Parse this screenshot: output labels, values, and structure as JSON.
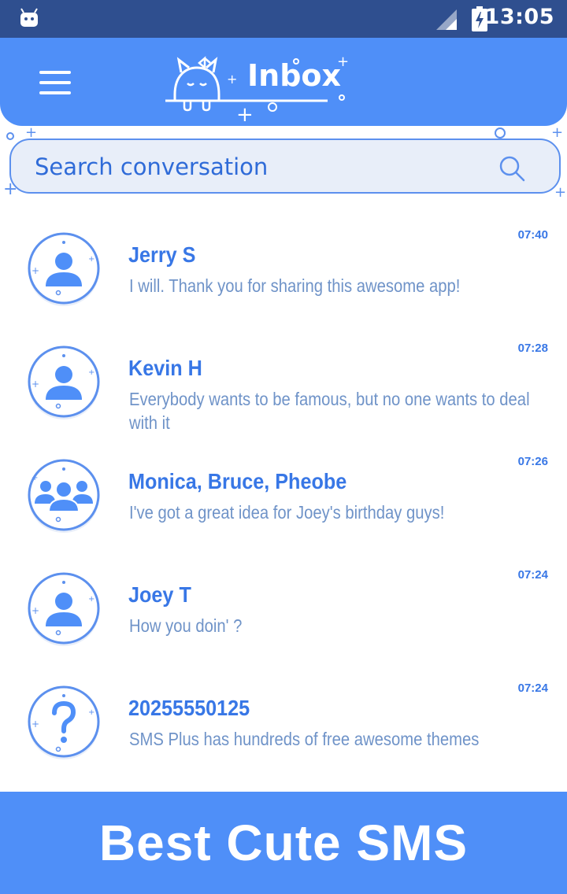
{
  "status_bar": {
    "time": "13:05"
  },
  "header": {
    "title": "Inbox",
    "menu_icon": "hamburger-menu-icon"
  },
  "search": {
    "placeholder": "Search conversation",
    "value": ""
  },
  "conversations": [
    {
      "name": "Jerry S",
      "preview": "I will. Thank you for sharing this awesome app!",
      "time": "07:40",
      "avatar": "person"
    },
    {
      "name": "Kevin H",
      "preview": "Everybody wants to be famous, but no one wants to deal with it",
      "time": "07:28",
      "avatar": "person"
    },
    {
      "name": "Monica, Bruce, Pheobe",
      "preview": "I've got a great idea for Joey's birthday guys!",
      "time": "07:26",
      "avatar": "group"
    },
    {
      "name": "Joey T",
      "preview": "How you doin' ?",
      "time": "07:24",
      "avatar": "person"
    },
    {
      "name": "20255550125",
      "preview": "SMS Plus has hundreds of free awesome themes",
      "time": "07:24",
      "avatar": "unknown"
    }
  ],
  "footer": {
    "banner": "Best Cute SMS"
  },
  "colors": {
    "primary": "#4f8ff8",
    "status_bar": "#2f4f8f",
    "text_primary": "#3877e6",
    "text_secondary": "#6f93c8"
  }
}
